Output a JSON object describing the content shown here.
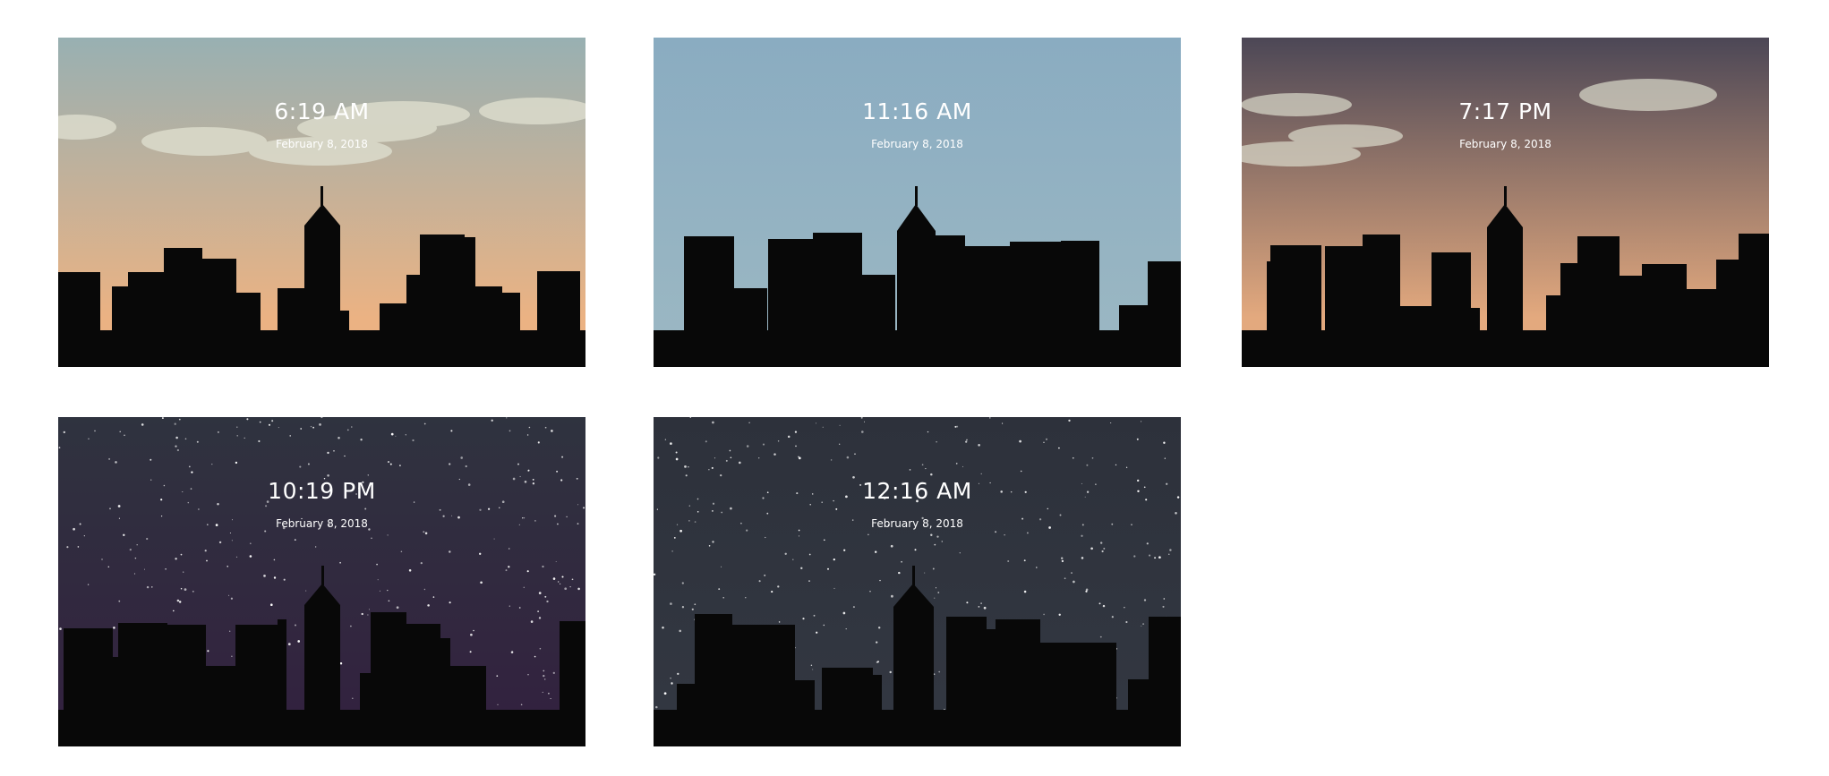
{
  "panels": [
    {
      "time": "6:19 AM",
      "date": "February 8, 2018",
      "scene": "sunrise",
      "sky_top": "#98b0b2",
      "sky_bottom": "#ebb283",
      "clouds": true,
      "stars": false
    },
    {
      "time": "11:16 AM",
      "date": "February 8, 2018",
      "scene": "day",
      "sky_top": "#8aacc1",
      "sky_bottom": "#9cb8c3",
      "clouds": false,
      "stars": false
    },
    {
      "time": "7:17 PM",
      "date": "February 8, 2018",
      "scene": "sunset",
      "sky_top": "#4c4756",
      "sky_bottom": "#e3a97e",
      "clouds": true,
      "stars": false
    },
    {
      "time": "10:19 PM",
      "date": "February 8, 2018",
      "scene": "night",
      "sky_top": "#2f333f",
      "sky_bottom": "#33203f",
      "clouds": false,
      "stars": true
    },
    {
      "time": "12:16 AM",
      "date": "February 8, 2018",
      "scene": "midnight",
      "sky_top": "#2d313b",
      "sky_bottom": "#333842",
      "clouds": false,
      "stars": true
    }
  ],
  "colors": {
    "silhouette": "#080808",
    "cloud": "#dcdccc",
    "star": "#ffffff",
    "text": "#ffffff"
  }
}
